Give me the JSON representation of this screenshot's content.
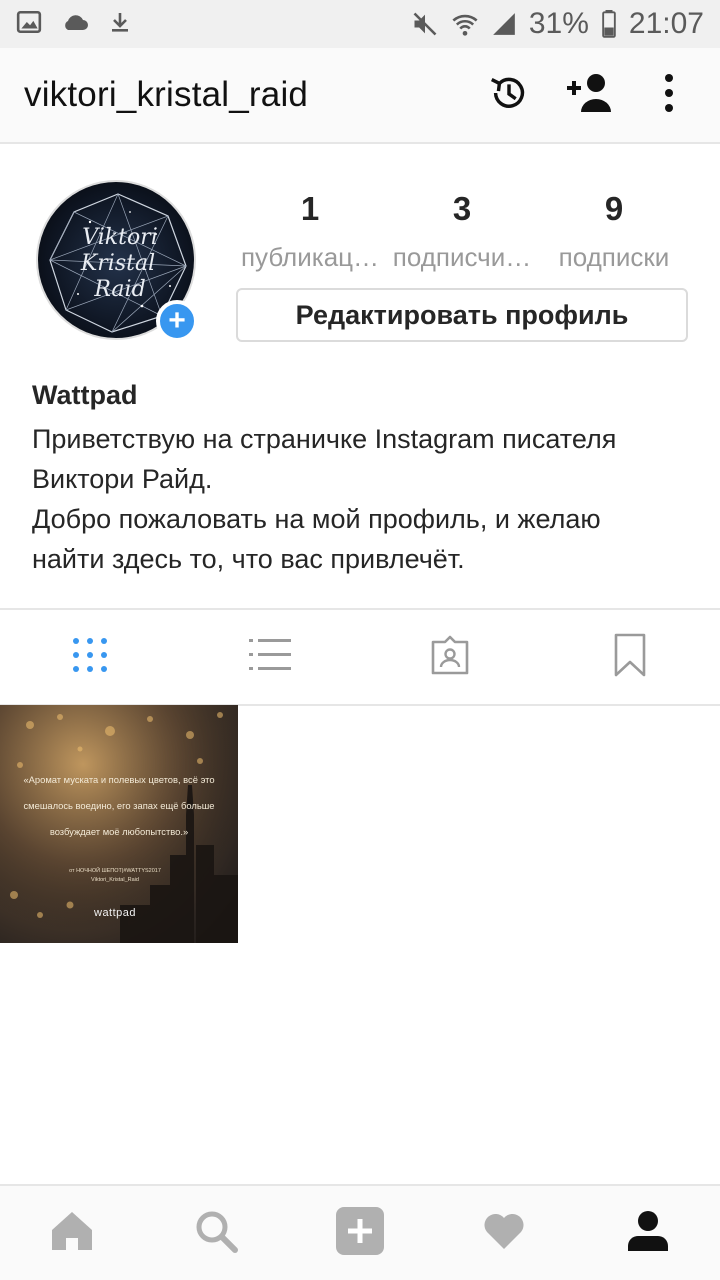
{
  "status_bar": {
    "battery": "31%",
    "time": "21:07",
    "icons": [
      "image-icon",
      "cloud-icon",
      "download-icon",
      "mute-icon",
      "wifi-icon",
      "signal-icon",
      "battery-icon"
    ]
  },
  "header": {
    "username": "viktori_kristal_raid",
    "icons": [
      "history-icon",
      "add-user-icon",
      "more-icon"
    ]
  },
  "profile": {
    "stats": [
      {
        "value": "1",
        "label": "публикац…"
      },
      {
        "value": "3",
        "label": "подписчи…"
      },
      {
        "value": "9",
        "label": "подписки"
      }
    ],
    "edit_button": "Редактировать профиль",
    "bio_name": "Wattpad",
    "bio_text": "Приветствую на страничке Instagram писателя\nВиктори Райд.\nДобро пожаловать на мой профиль, и желаю\nнайти здесь то, что вас привлечёт."
  },
  "tabs": [
    "grid-icon",
    "list-icon",
    "tagged-icon",
    "saved-icon"
  ],
  "posts": [
    {
      "quote": "«Аромат муската и полевых цветов, всё это смешалось воедино, его запах ещё больше возбуждает моё любопытство.»",
      "credit": "от НОЧНОЙ ШЕПОТ|#WATTYS2017 Viktori_Kristal_Raid",
      "brand": "wattpad"
    }
  ],
  "bottom_nav": [
    "home-icon",
    "search-icon",
    "add-post-icon",
    "activity-heart-icon",
    "profile-icon"
  ],
  "colors": {
    "accent": "#3897f0",
    "text": "#262626",
    "muted": "#999999",
    "icon_gray": "#b0b0b0"
  }
}
